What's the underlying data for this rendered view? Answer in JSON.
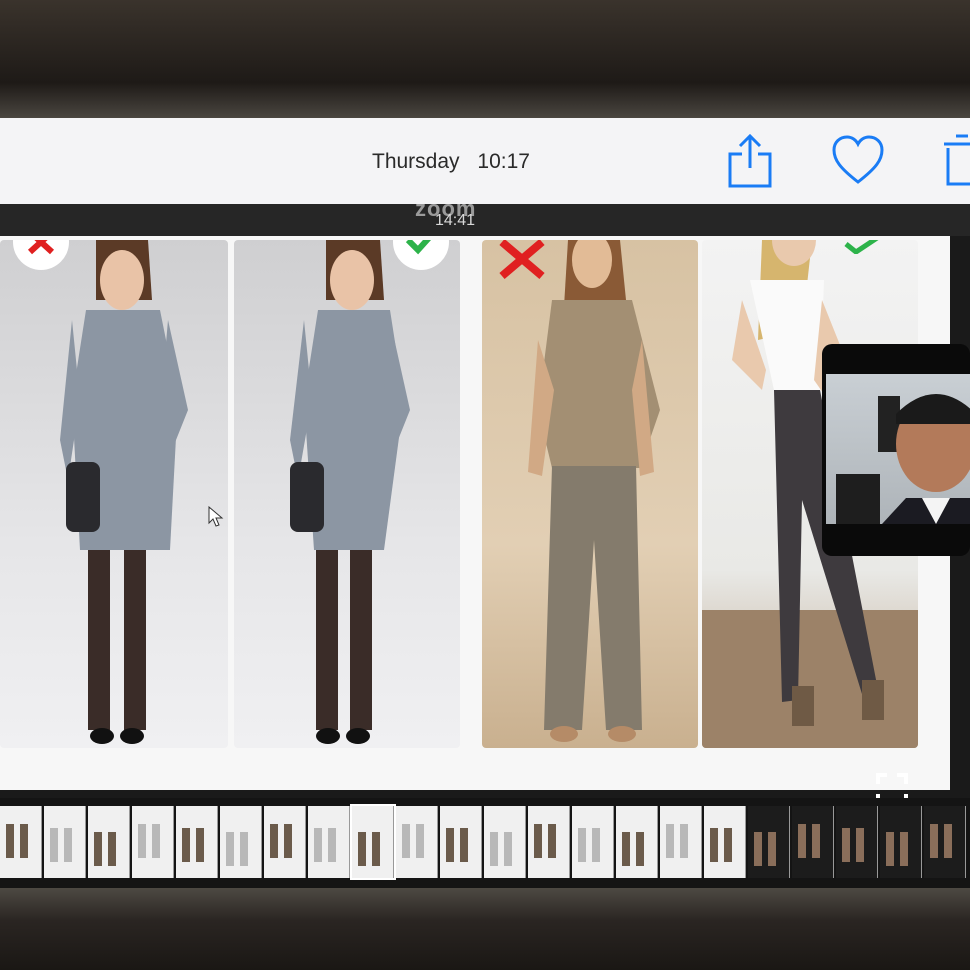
{
  "header": {
    "day": "Thursday",
    "time": "10:17"
  },
  "zoom_banner": {
    "brand": "zoom",
    "timestamp": "14:41"
  },
  "icons": {
    "share": "share-icon",
    "favorite": "heart-icon",
    "delete": "trash-icon",
    "fullscreen": "fullscreen-icon",
    "cursor": "cursor-icon"
  },
  "colors": {
    "accent": "#1a7cf5",
    "reject": "#e02020",
    "approve": "#2db34a"
  },
  "slide": {
    "photos": [
      {
        "name": "gray-dress-photo",
        "verdict": "reject"
      },
      {
        "name": "gray-dress-tailored-photo",
        "verdict": "approve"
      },
      {
        "name": "loose-top-wide-jeans-photo",
        "verdict": "reject"
      },
      {
        "name": "white-top-skinny-jeans-photo",
        "verdict": "approve"
      }
    ]
  },
  "filmstrip": {
    "thumbnail_count": 22,
    "current_index": 8
  }
}
